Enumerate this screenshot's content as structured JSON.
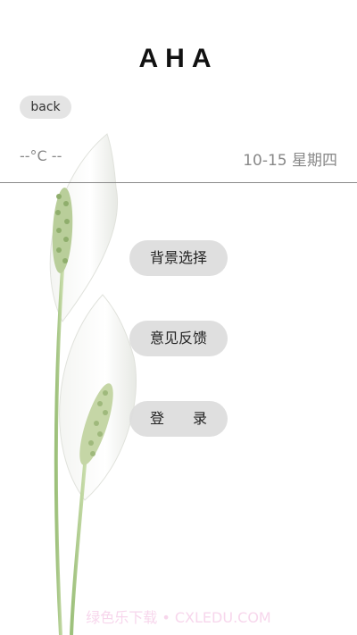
{
  "header": {
    "title": "AHA"
  },
  "toolbar": {
    "back_label": "back"
  },
  "weather": {
    "temperature": "--°C --"
  },
  "date": {
    "text": "10-15 星期四"
  },
  "menu": {
    "background_select": "背景选择",
    "feedback": "意见反馈",
    "login": "登　　录"
  },
  "watermark": {
    "text": "绿色乐下载 • CXLEDU.COM"
  },
  "colors": {
    "divider": "#8a8a8a",
    "button_bg": "#dcdcdc",
    "title": "#111111"
  }
}
